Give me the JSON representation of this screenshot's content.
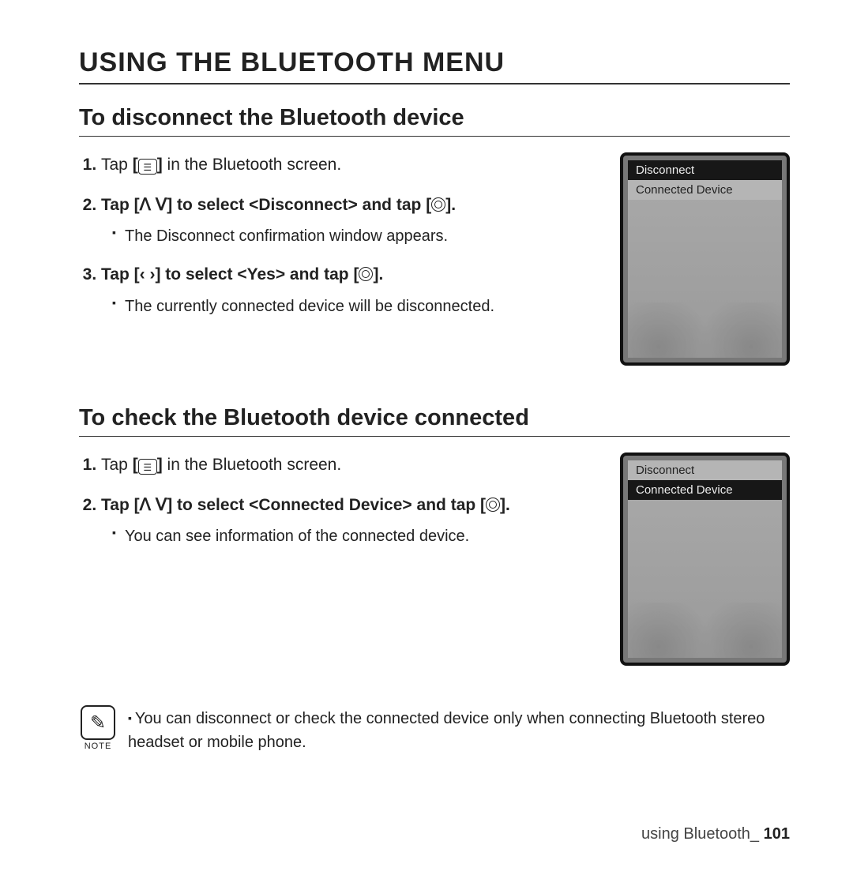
{
  "title": "USING THE BLUETOOTH MENU",
  "section1": {
    "heading": "To disconnect the Bluetooth device",
    "steps": {
      "s1a": "Tap ",
      "s1b": " in the Bluetooth screen.",
      "s2a": "Tap ",
      "s2b": " to select ",
      "s2opt": "<Disconnect>",
      "s2c": " and tap ",
      "s2d": ".",
      "s2sub": "The Disconnect confirmation window appears.",
      "s3a": "Tap ",
      "s3b": " to select ",
      "s3opt": "<Yes>",
      "s3c": " and tap ",
      "s3d": ".",
      "s3sub": "The currently connected device will be disconnected."
    },
    "device": {
      "item1": "Disconnect",
      "item2": "Connected Device",
      "highlight": "item1"
    }
  },
  "section2": {
    "heading": "To check the Bluetooth device connected",
    "steps": {
      "s1a": "Tap ",
      "s1b": " in the Bluetooth screen.",
      "s2a": "Tap ",
      "s2b": " to select ",
      "s2opt": "<Connected Device>",
      "s2c": " and tap ",
      "s2d": ".",
      "s2sub": "You can see information of the connected device."
    },
    "device": {
      "item1": "Disconnect",
      "item2": "Connected  Device",
      "highlight": "item2"
    }
  },
  "glyphs": {
    "bracket_open": "[",
    "bracket_close": "]",
    "updown": "ꓥ ꓦ",
    "leftright": "‹  ›"
  },
  "note": {
    "label": "NOTE",
    "text": "You can disconnect or check the connected device only when connecting Bluetooth stereo headset or mobile phone."
  },
  "footer": {
    "section": "using Bluetooth_",
    "page": "101"
  }
}
